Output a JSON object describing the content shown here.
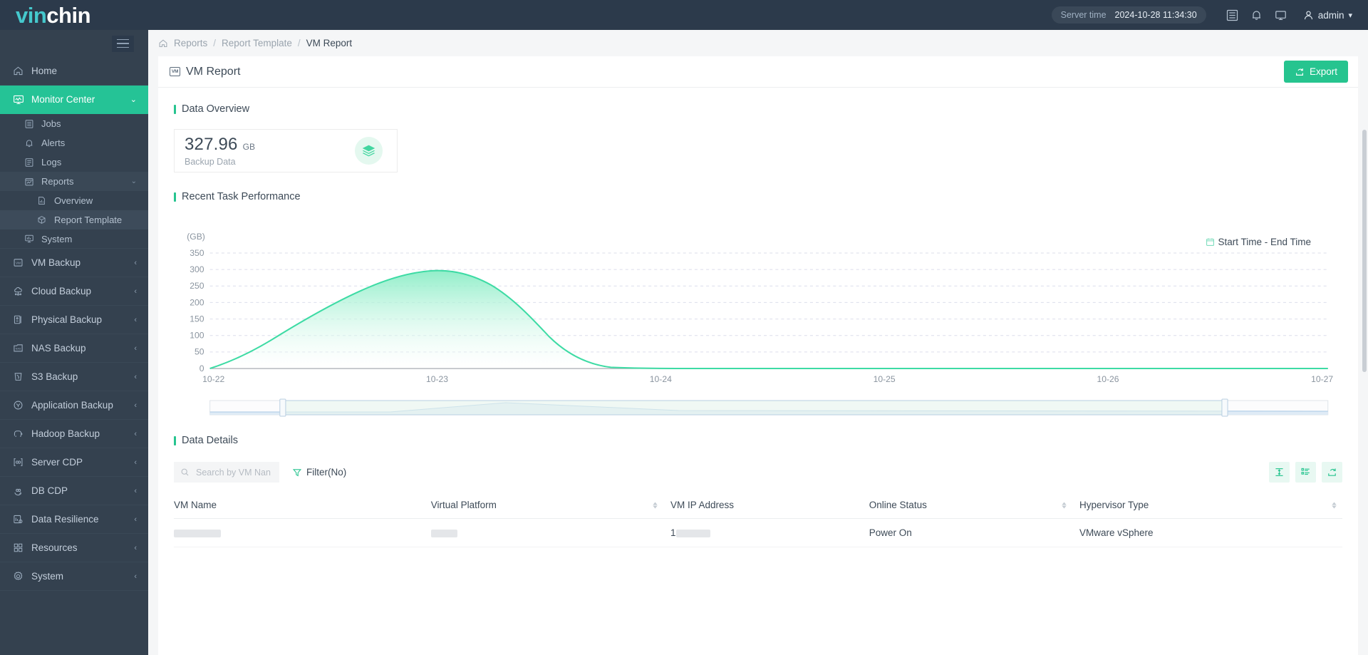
{
  "brand": {
    "part1": "vin",
    "part2": "chin",
    "accent": "#45c8cd"
  },
  "topbar": {
    "server_time_label": "Server time",
    "server_time_value": "2024-10-28 11:34:30",
    "icons": [
      "list-icon",
      "bell-icon",
      "monitor-icon"
    ],
    "user": "admin"
  },
  "sidebar": {
    "items": [
      {
        "label": "Home",
        "icon": "home-icon",
        "type": "item"
      },
      {
        "label": "Monitor Center",
        "icon": "monitor-center-icon",
        "type": "item",
        "active": true,
        "chev": "⌄"
      },
      {
        "label": "Jobs",
        "icon": "jobs-icon",
        "type": "sub"
      },
      {
        "label": "Alerts",
        "icon": "alerts-bell-icon",
        "type": "sub"
      },
      {
        "label": "Logs",
        "icon": "logs-icon",
        "type": "sub"
      },
      {
        "label": "Reports",
        "icon": "reports-icon",
        "type": "subgroup",
        "chev": "⌄"
      },
      {
        "label": "Overview",
        "icon": "overview-doc-icon",
        "type": "deep"
      },
      {
        "label": "Report Template",
        "icon": "report-template-box-icon",
        "type": "deep",
        "selected": true
      },
      {
        "label": "System",
        "icon": "system-chart-icon",
        "type": "sub"
      },
      {
        "label": "VM Backup",
        "icon": "vm-backup-icon",
        "type": "item",
        "chev": "‹"
      },
      {
        "label": "Cloud Backup",
        "icon": "cloud-backup-icon",
        "type": "item",
        "chev": "‹"
      },
      {
        "label": "Physical Backup",
        "icon": "physical-backup-icon",
        "type": "item",
        "chev": "‹"
      },
      {
        "label": "NAS Backup",
        "icon": "nas-backup-icon",
        "type": "item",
        "chev": "‹"
      },
      {
        "label": "S3 Backup",
        "icon": "s3-backup-icon",
        "type": "item",
        "chev": "‹"
      },
      {
        "label": "Application Backup",
        "icon": "application-backup-icon",
        "type": "item",
        "chev": "‹"
      },
      {
        "label": "Hadoop Backup",
        "icon": "hadoop-backup-icon",
        "type": "item",
        "chev": "‹"
      },
      {
        "label": "Server CDP",
        "icon": "server-cdp-icon",
        "type": "item",
        "chev": "‹"
      },
      {
        "label": "DB CDP",
        "icon": "db-cdp-icon",
        "type": "item",
        "chev": "‹"
      },
      {
        "label": "Data Resilience",
        "icon": "data-resilience-icon",
        "type": "item",
        "chev": "‹"
      },
      {
        "label": "Resources",
        "icon": "resources-icon",
        "type": "item",
        "chev": "‹"
      },
      {
        "label": "System",
        "icon": "settings-gear-icon",
        "type": "item",
        "chev": "‹"
      }
    ]
  },
  "breadcrumb": {
    "home_icon": "home-icon",
    "items": [
      "Reports",
      "Report Template",
      "VM Report"
    ],
    "separator": "/"
  },
  "page": {
    "title": "VM Report",
    "title_badge": "VM",
    "export_label": "Export"
  },
  "data_overview": {
    "section_title": "Data Overview",
    "value": "327.96",
    "unit": "GB",
    "label": "Backup Data",
    "icon": "layers-icon",
    "icon_bg": "#e4f8ef",
    "icon_color": "#43d6a0"
  },
  "recent_task_performance": {
    "section_title": "Recent Task Performance",
    "date_range_placeholder": "Start Time - End Time",
    "calendar_icon": "calendar-icon"
  },
  "chart_data": {
    "type": "area",
    "title": "Recent Task Performance",
    "ylabel": "(GB)",
    "xlabel": "",
    "ylim": [
      0,
      350
    ],
    "yticks": [
      0,
      50,
      100,
      150,
      200,
      250,
      300,
      350
    ],
    "categories": [
      "10-22",
      "10-23",
      "10-24",
      "10-25",
      "10-26",
      "10-27"
    ],
    "grid": true,
    "legend": "none",
    "line_color": "#3ddba4",
    "fill_top_color": "#8bedc6",
    "fill_bottom_color": "#ffffff",
    "x": [
      0,
      0.08,
      0.16,
      0.24,
      0.32,
      0.4,
      0.48,
      0.56,
      0.64,
      0.72,
      0.8,
      0.88,
      0.96,
      1.04,
      1.12,
      1.2,
      1.28,
      1.36,
      1.44,
      1.52,
      1.6,
      1.7,
      1.85,
      2.0,
      2.5,
      3.0,
      3.5,
      4.0,
      4.5,
      5.0
    ],
    "values": [
      0,
      22,
      48,
      78,
      108,
      140,
      170,
      196,
      220,
      243,
      262,
      278,
      290,
      298,
      302,
      301,
      295,
      282,
      260,
      228,
      186,
      130,
      62,
      14,
      2,
      1,
      1,
      1,
      1,
      1
    ],
    "peak_value": 302,
    "peak_x": "10-23",
    "datazoom": {
      "start_pct": 6.5,
      "end_pct": 91,
      "visible": true
    }
  },
  "data_details": {
    "section_title": "Data Details",
    "search_placeholder": "Search by VM Nan",
    "search_value": "",
    "search_icon": "search-icon",
    "filter_label": "Filter(No)",
    "filter_icon": "funnel-icon",
    "tool_icons": [
      "row-height-icon",
      "column-settings-icon",
      "export-share-icon"
    ],
    "columns": [
      {
        "label": "VM Name",
        "sortable": false
      },
      {
        "label": "Virtual Platform",
        "sortable": false
      },
      {
        "label": "VM IP Address",
        "sortable": true
      },
      {
        "label": "Online Status",
        "sortable": false
      },
      {
        "label": "Hypervisor Type",
        "sortable": true
      }
    ],
    "rows": [
      {
        "vm_name": "",
        "virtual_platform": "",
        "vm_ip_address": "1",
        "online_status": "Power On",
        "hypervisor_type": "VMware vSphere"
      }
    ]
  }
}
